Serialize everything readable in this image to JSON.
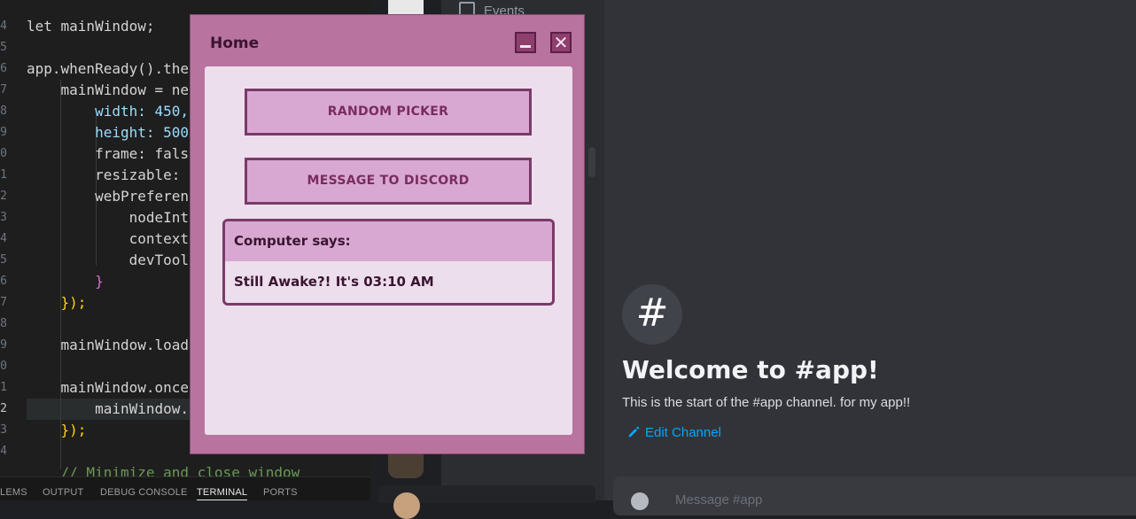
{
  "editor": {
    "line_numbers": [
      "4",
      "5",
      "6",
      "7",
      "8",
      "9",
      "0",
      "1",
      "2",
      "3",
      "4",
      "5",
      "6",
      "7",
      "8",
      "9",
      "0",
      "1",
      "2",
      "3",
      "4"
    ],
    "active_line_number": "2",
    "lines": [
      "let mainWindow;",
      "",
      "app.whenReady().the",
      "    mainWindow = ne",
      "        width: 450,",
      "        height: 500",
      "        frame: fals",
      "        resizable: ",
      "        webPreferen",
      "            nodeInt",
      "            context",
      "            devTool",
      "        }",
      "    });",
      "",
      "    mainWindow.load",
      "",
      "    mainWindow.once",
      "        mainWindow.",
      "    });",
      "",
      "    // Minimize and close window"
    ],
    "panel_tabs": [
      "LEMS",
      "OUTPUT",
      "DEBUG CONSOLE",
      "TERMINAL",
      "PORTS"
    ],
    "active_panel_tab": "TERMINAL"
  },
  "discord": {
    "channel_item": "Events",
    "welcome_title": "Welcome to #app!",
    "welcome_sub": "This is the start of the #app channel. for my app!!",
    "edit_channel": "Edit Channel",
    "hash_symbol": "#",
    "message_placeholder": "Message #app"
  },
  "app": {
    "title": "Home",
    "close_glyph": "✕",
    "buttons": {
      "random_picker": "RANDOM PICKER",
      "message_discord": "MESSAGE TO DISCORD"
    },
    "computer_says": {
      "header": "Computer says:",
      "message": "Still Awake?! It's 03:10 AM"
    }
  },
  "colors": {
    "app_frame": "#b8739e",
    "app_body": "#ecdeec",
    "button_fill": "#d8a8d2",
    "button_border": "#7a3a68",
    "discord_link": "#00a8fc"
  }
}
